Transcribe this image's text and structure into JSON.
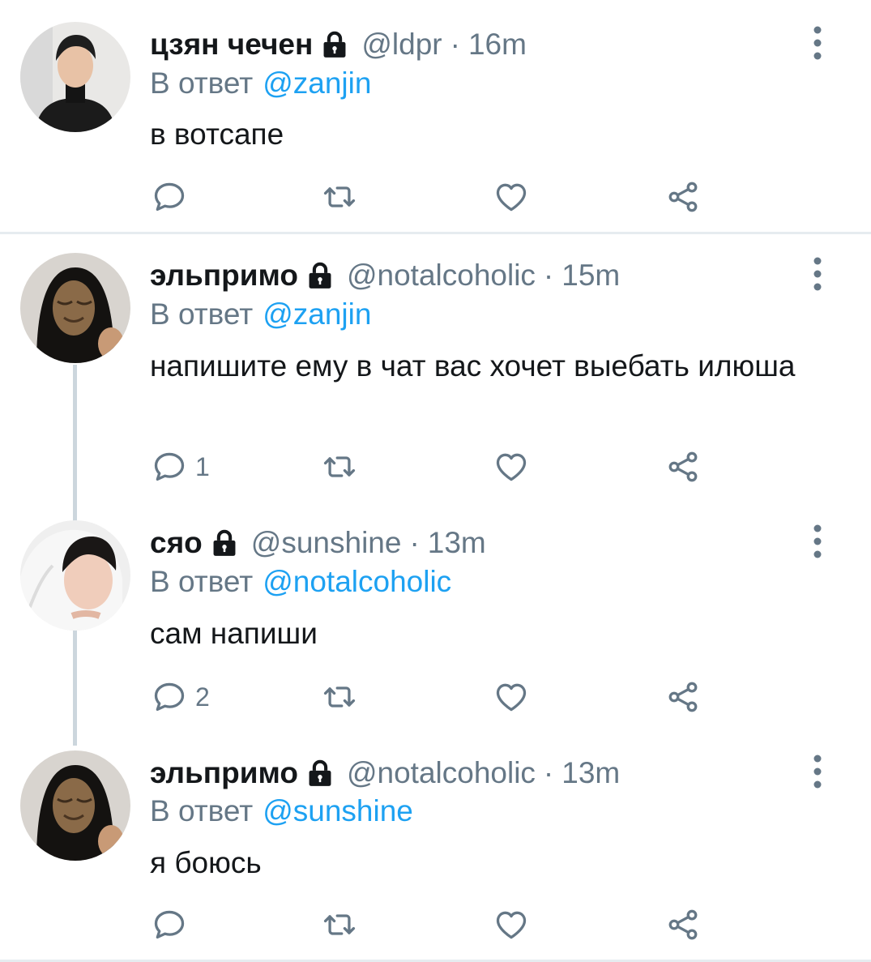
{
  "tweets": [
    {
      "name": "цзян чечен",
      "handle": "@ldpr",
      "sep": "·",
      "time": "16m",
      "reply_prefix": "В ответ",
      "reply_to": "@zanjin",
      "text": "в вотсапе",
      "reply_count": "",
      "avatar": "avatar-1"
    },
    {
      "name": "эльпримо",
      "handle": "@notalcoholic",
      "sep": "·",
      "time": "15m",
      "reply_prefix": "В ответ",
      "reply_to": "@zanjin",
      "text": "напишите ему в чат вас хочет выебать илюша",
      "reply_count": "1",
      "avatar": "avatar-2"
    },
    {
      "name": "сяо",
      "handle": "@sunshine",
      "sep": "·",
      "time": "13m",
      "reply_prefix": "В ответ",
      "reply_to": "@notalcoholic",
      "text": "сам напиши",
      "reply_count": "2",
      "avatar": "avatar-3"
    },
    {
      "name": "эльпримо",
      "handle": "@notalcoholic",
      "sep": "·",
      "time": "13m",
      "reply_prefix": "В ответ",
      "reply_to": "@sunshine",
      "text": "я боюсь",
      "reply_count": "",
      "avatar": "avatar-2"
    }
  ],
  "icons": {
    "reply": "reply-icon",
    "retweet": "retweet-icon",
    "like": "heart-icon",
    "share": "share-icon",
    "menu": "more-vertical-icon",
    "lock": "lock-icon"
  },
  "colors": {
    "text": "#14171a",
    "muted": "#657786",
    "link": "#1da1f2",
    "divider": "#e6ecf0",
    "thread": "#ccd6dd"
  }
}
